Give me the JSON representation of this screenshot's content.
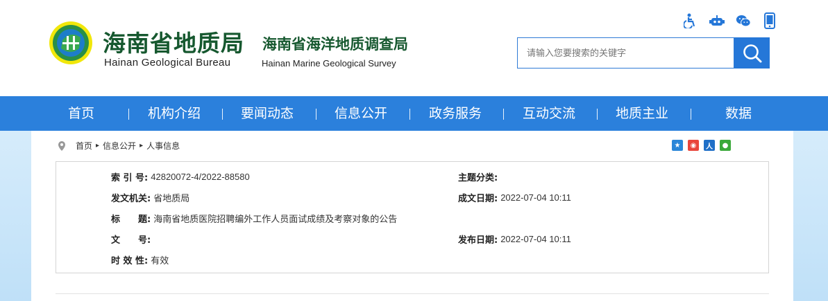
{
  "brand": {
    "name_cn": "海南省地质局",
    "name_cn2": "海南省海洋地质调查局",
    "name_en": "Hainan Geological Bureau",
    "name_en2": "Hainan Marine Geological Survey"
  },
  "tools": [
    "accessibility-icon",
    "robot-icon",
    "wechat-icon",
    "mobile-icon"
  ],
  "search": {
    "placeholder": "请输入您要搜索的关键字"
  },
  "nav": {
    "items": [
      {
        "label": "首页"
      },
      {
        "label": "机构介绍"
      },
      {
        "label": "要闻动态"
      },
      {
        "label": "信息公开"
      },
      {
        "label": "政务服务"
      },
      {
        "label": "互动交流"
      },
      {
        "label": "地质主业"
      },
      {
        "label": "数据"
      }
    ]
  },
  "breadcrumb": {
    "home": "首页",
    "sep": "▸",
    "level1": "信息公开",
    "level2": "人事信息"
  },
  "share": [
    "qzone-icon",
    "weibo-icon",
    "renren-icon",
    "wechat-share-icon"
  ],
  "colors": {
    "nav_bg": "#2b80dc",
    "brand_green": "#16582f",
    "search_accent": "#2577d8"
  },
  "meta": {
    "index_label": "索 引 号:",
    "index_value": "42820072-4/2022-88580",
    "topic_label": "主题分类:",
    "topic_value": "",
    "issuer_label": "发文机关:",
    "issuer_value": "省地质局",
    "created_label": "成文日期:",
    "created_value": "2022-07-04 10:11",
    "title_label": "标　　题:",
    "title_value": "海南省地质医院招聘编外工作人员面试成绩及考察对象的公告",
    "docno_label": "文　　号:",
    "docno_value": "",
    "published_label": "发布日期:",
    "published_value": "2022-07-04 10:11",
    "validity_label": "时 效 性:",
    "validity_value": "有效"
  }
}
